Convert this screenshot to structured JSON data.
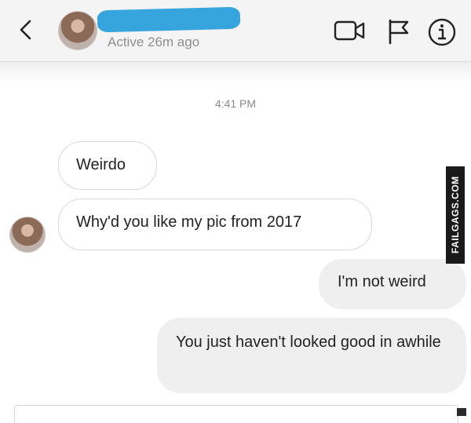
{
  "header": {
    "status": "Active 26m ago",
    "icons": {
      "back": "chevron-left-icon",
      "video": "video-camera-icon",
      "flag": "flag-icon",
      "info": "info-icon"
    }
  },
  "thread": {
    "timestamp": "4:41 PM",
    "messages": [
      {
        "from": "them",
        "text": "Weirdo"
      },
      {
        "from": "them",
        "text": "Why'd you like my pic from 2017"
      },
      {
        "from": "me",
        "text": "I'm not weird"
      },
      {
        "from": "me",
        "text": "You just haven't looked good in awhile"
      }
    ]
  },
  "watermark": "FAILGAGS.COM",
  "colors": {
    "redaction": "#36a4dd",
    "outgoing_bubble": "#efefef",
    "incoming_border": "#d8d8d8"
  }
}
